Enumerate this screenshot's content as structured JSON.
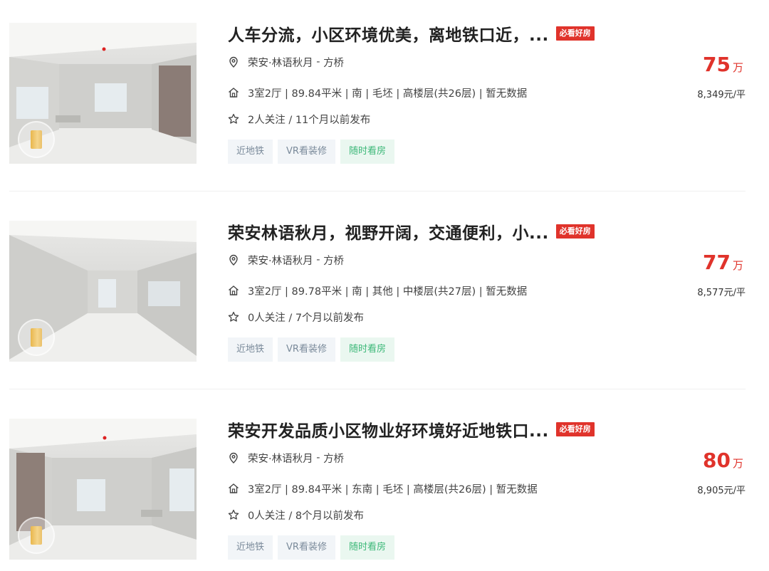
{
  "listings": [
    {
      "title": "人车分流，小区环境优美，离地铁口近，...",
      "badge": "必看好房",
      "location_community": "荣安·林语秋月",
      "location_sep": " - ",
      "location_area": "方桥",
      "house_info": "3室2厅 | 89.84平米 | 南 | 毛坯 | 高楼层(共26层) | 暂无数据",
      "follow_info": "2人关注 / 11个月以前发布",
      "tags": [
        "近地铁",
        "VR看装修",
        "随时看房"
      ],
      "price": "75",
      "price_unit": "万",
      "unit_price": "8,349元/平"
    },
    {
      "title": "荣安林语秋月，视野开阔，交通便利，小...",
      "badge": "必看好房",
      "location_community": "荣安·林语秋月",
      "location_sep": " - ",
      "location_area": "方桥",
      "house_info": "3室2厅 | 89.78平米 | 南 | 其他 | 中楼层(共27层) | 暂无数据",
      "follow_info": "0人关注 / 7个月以前发布",
      "tags": [
        "近地铁",
        "VR看装修",
        "随时看房"
      ],
      "price": "77",
      "price_unit": "万",
      "unit_price": "8,577元/平"
    },
    {
      "title": "荣安开发品质小区物业好环境好近地铁口...",
      "badge": "必看好房",
      "location_community": "荣安·林语秋月",
      "location_sep": " - ",
      "location_area": "方桥",
      "house_info": "3室2厅 | 89.84平米 | 东南 | 毛坯 | 高楼层(共26层) | 暂无数据",
      "follow_info": "0人关注 / 8个月以前发布",
      "tags": [
        "近地铁",
        "VR看装修",
        "随时看房"
      ],
      "price": "80",
      "price_unit": "万",
      "unit_price": "8,905元/平"
    }
  ],
  "icons": {
    "location": "location-pin-icon",
    "house": "house-icon",
    "follow": "star-icon",
    "vr": "vr-cube-icon"
  },
  "colors": {
    "price": "#e0332b",
    "badge_bg": "#e0332b",
    "tag_bg": "#f2f5f8",
    "tag_green_bg": "#eaf7f0",
    "tag_green_text": "#3cb878"
  }
}
